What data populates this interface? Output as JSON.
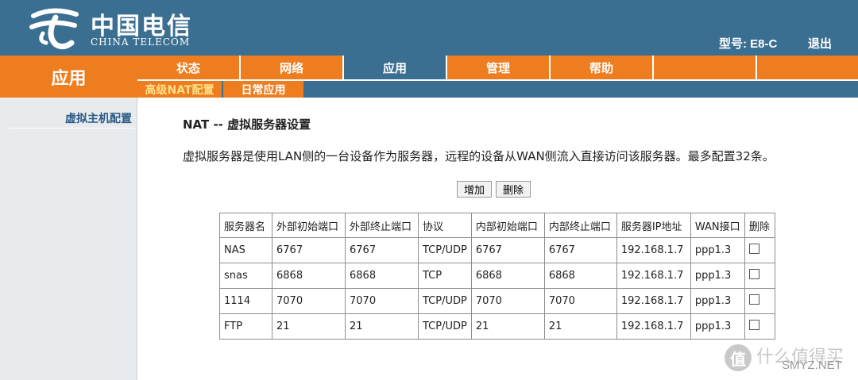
{
  "header": {
    "logo_cn": "中国电信",
    "logo_en": "CHINA TELECOM",
    "model": "型号: E8-C",
    "logout": "退出"
  },
  "section_title": "应用",
  "main_nav": [
    {
      "label": "状态",
      "active": false
    },
    {
      "label": "网络",
      "active": false
    },
    {
      "label": "应用",
      "active": true
    },
    {
      "label": "管理",
      "active": false
    },
    {
      "label": "帮助",
      "active": false
    },
    {
      "label": "",
      "active": false
    },
    {
      "label": "",
      "active": false
    }
  ],
  "sub_nav": [
    {
      "label": "高级NAT配置",
      "active": true
    },
    {
      "label": "日常应用",
      "active": false
    }
  ],
  "sidebar": {
    "items": [
      {
        "label": "虚拟主机配置"
      }
    ]
  },
  "content": {
    "title": "NAT -- 虚拟服务器设置",
    "description": "虚拟服务器是使用LAN侧的一台设备作为服务器，远程的设备从WAN侧流入直接访问该服务器。最多配置32条。",
    "add_label": "增加",
    "delete_label": "删除"
  },
  "table": {
    "headers": [
      "服务器名",
      "外部初始端口",
      "外部终止端口",
      "协议",
      "内部初始端口",
      "内部终止端口",
      "服务器IP地址",
      "WAN接口",
      "删除"
    ],
    "rows": [
      {
        "name": "NAS",
        "ext_start": "6767",
        "ext_end": "6767",
        "protocol": "TCP/UDP",
        "int_start": "6767",
        "int_end": "6767",
        "ip": "192.168.1.7",
        "wan": "ppp1.3"
      },
      {
        "name": "snas",
        "ext_start": "6868",
        "ext_end": "6868",
        "protocol": "TCP",
        "int_start": "6868",
        "int_end": "6868",
        "ip": "192.168.1.7",
        "wan": "ppp1.3"
      },
      {
        "name": "1114",
        "ext_start": "7070",
        "ext_end": "7070",
        "protocol": "TCP/UDP",
        "int_start": "7070",
        "int_end": "7070",
        "ip": "192.168.1.7",
        "wan": "ppp1.3"
      },
      {
        "name": "FTP",
        "ext_start": "21",
        "ext_end": "21",
        "protocol": "TCP/UDP",
        "int_start": "21",
        "int_end": "21",
        "ip": "192.168.1.7",
        "wan": "ppp1.3"
      }
    ]
  },
  "watermark": {
    "glyph": "值",
    "text": "什么值得买",
    "url": "SMYZ.NET"
  },
  "colors": {
    "header_blue": "#3b6f92",
    "accent_orange": "#ee7d20"
  }
}
